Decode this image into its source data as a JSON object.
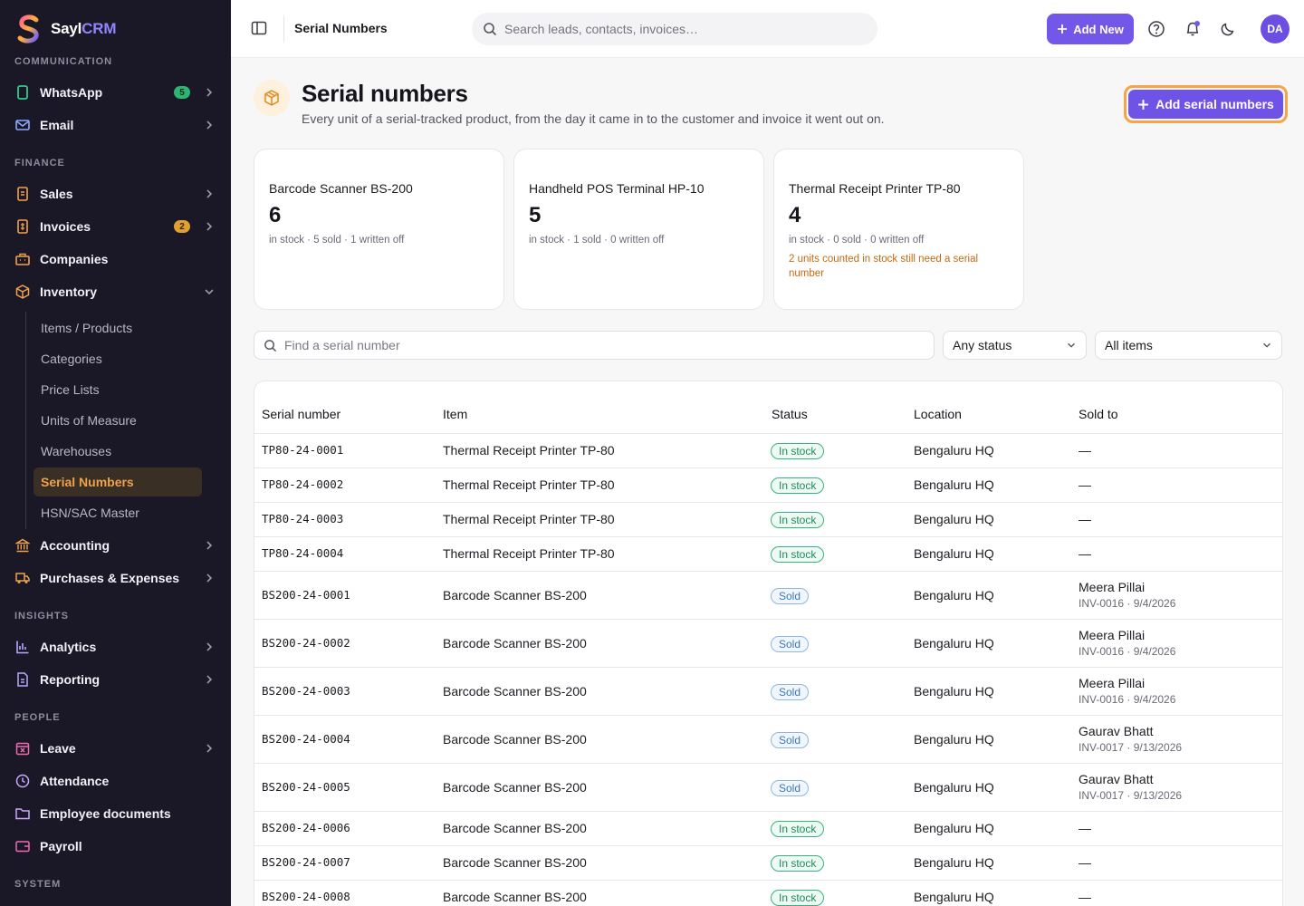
{
  "brand": {
    "name_a": "Sayl",
    "name_b": "CRM"
  },
  "sidebar": {
    "sections": {
      "communication": "COMMUNICATION",
      "finance": "FINANCE",
      "insights": "INSIGHTS",
      "people": "PEOPLE",
      "system": "SYSTEM"
    },
    "items": {
      "whatsapp": {
        "label": "WhatsApp",
        "badge": "5"
      },
      "email": {
        "label": "Email"
      },
      "sales": {
        "label": "Sales"
      },
      "invoices": {
        "label": "Invoices",
        "badge": "2"
      },
      "companies": {
        "label": "Companies"
      },
      "inventory": {
        "label": "Inventory"
      },
      "accounting": {
        "label": "Accounting"
      },
      "purchases": {
        "label": "Purchases & Expenses"
      },
      "analytics": {
        "label": "Analytics"
      },
      "reporting": {
        "label": "Reporting"
      },
      "leave": {
        "label": "Leave"
      },
      "attendance": {
        "label": "Attendance"
      },
      "employee_docs": {
        "label": "Employee documents"
      },
      "payroll": {
        "label": "Payroll"
      }
    },
    "inventory_sub": [
      "Items / Products",
      "Categories",
      "Price Lists",
      "Units of Measure",
      "Warehouses",
      "Serial Numbers",
      "HSN/SAC Master"
    ],
    "active_sub": "Serial Numbers"
  },
  "topbar": {
    "title": "Serial Numbers",
    "search_placeholder": "Search leads, contacts, invoices…",
    "add_new": "Add New",
    "avatar": "DA"
  },
  "page": {
    "title": "Serial numbers",
    "subtitle": "Every unit of a serial-tracked product, from the day it came in to the customer and invoice it went out on.",
    "add_button": "Add serial numbers"
  },
  "cards": [
    {
      "name": "Barcode Scanner BS-200",
      "count": "6",
      "meta": "in stock · 5 sold · 1 written off",
      "warning": ""
    },
    {
      "name": "Handheld POS Terminal HP-10",
      "count": "5",
      "meta": "in stock · 1 sold · 0 written off",
      "warning": ""
    },
    {
      "name": "Thermal Receipt Printer TP-80",
      "count": "4",
      "meta": "in stock · 0 sold · 0 written off",
      "warning": "2 units counted in stock still need a serial number"
    }
  ],
  "filters": {
    "find_placeholder": "Find a serial number",
    "status": "Any status",
    "items": "All items"
  },
  "table": {
    "headers": {
      "serial": "Serial number",
      "item": "Item",
      "status": "Status",
      "location": "Location",
      "sold_to": "Sold to"
    },
    "rows": [
      {
        "serial": "TP80-24-0001",
        "item": "Thermal Receipt Printer TP-80",
        "status": "In stock",
        "location": "Bengaluru HQ",
        "buyer": "—",
        "invoice": ""
      },
      {
        "serial": "TP80-24-0002",
        "item": "Thermal Receipt Printer TP-80",
        "status": "In stock",
        "location": "Bengaluru HQ",
        "buyer": "—",
        "invoice": ""
      },
      {
        "serial": "TP80-24-0003",
        "item": "Thermal Receipt Printer TP-80",
        "status": "In stock",
        "location": "Bengaluru HQ",
        "buyer": "—",
        "invoice": ""
      },
      {
        "serial": "TP80-24-0004",
        "item": "Thermal Receipt Printer TP-80",
        "status": "In stock",
        "location": "Bengaluru HQ",
        "buyer": "—",
        "invoice": ""
      },
      {
        "serial": "BS200-24-0001",
        "item": "Barcode Scanner BS-200",
        "status": "Sold",
        "location": "Bengaluru HQ",
        "buyer": "Meera Pillai",
        "invoice": "INV-0016 · 9/4/2026"
      },
      {
        "serial": "BS200-24-0002",
        "item": "Barcode Scanner BS-200",
        "status": "Sold",
        "location": "Bengaluru HQ",
        "buyer": "Meera Pillai",
        "invoice": "INV-0016 · 9/4/2026"
      },
      {
        "serial": "BS200-24-0003",
        "item": "Barcode Scanner BS-200",
        "status": "Sold",
        "location": "Bengaluru HQ",
        "buyer": "Meera Pillai",
        "invoice": "INV-0016 · 9/4/2026"
      },
      {
        "serial": "BS200-24-0004",
        "item": "Barcode Scanner BS-200",
        "status": "Sold",
        "location": "Bengaluru HQ",
        "buyer": "Gaurav Bhatt",
        "invoice": "INV-0017 · 9/13/2026"
      },
      {
        "serial": "BS200-24-0005",
        "item": "Barcode Scanner BS-200",
        "status": "Sold",
        "location": "Bengaluru HQ",
        "buyer": "Gaurav Bhatt",
        "invoice": "INV-0017 · 9/13/2026"
      },
      {
        "serial": "BS200-24-0006",
        "item": "Barcode Scanner BS-200",
        "status": "In stock",
        "location": "Bengaluru HQ",
        "buyer": "—",
        "invoice": ""
      },
      {
        "serial": "BS200-24-0007",
        "item": "Barcode Scanner BS-200",
        "status": "In stock",
        "location": "Bengaluru HQ",
        "buyer": "—",
        "invoice": ""
      },
      {
        "serial": "BS200-24-0008",
        "item": "Barcode Scanner BS-200",
        "status": "In stock",
        "location": "Bengaluru HQ",
        "buyer": "—",
        "invoice": ""
      }
    ]
  },
  "colors": {
    "accent": "#7257e8",
    "highlight": "#f7a347",
    "sidebar_bg": "#1a1827",
    "in_stock": "#36b37e",
    "sold": "#3c78b8"
  }
}
